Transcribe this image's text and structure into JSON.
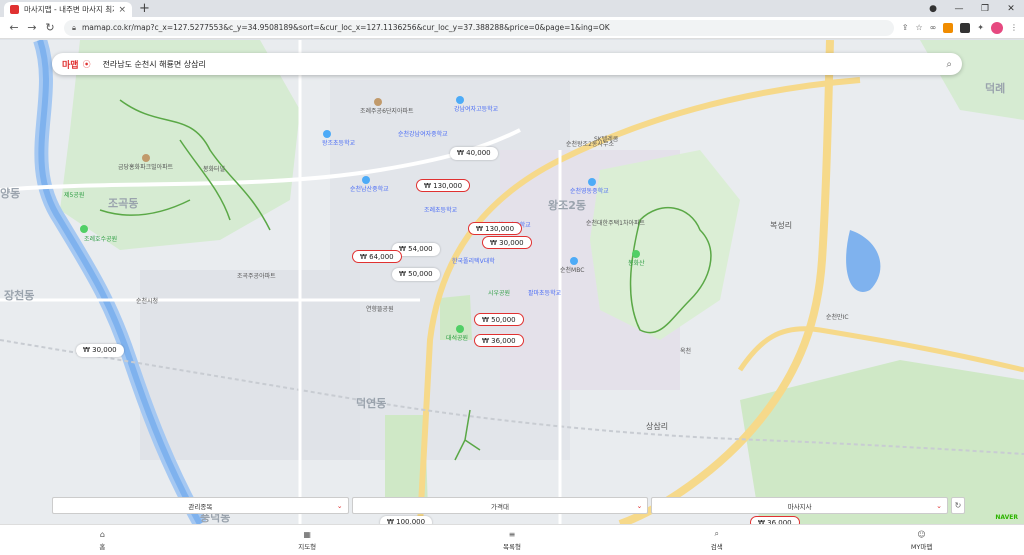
{
  "browser": {
    "tab_title": "마사지맵 - 내주변 마사지 최저가",
    "tab_close": "×",
    "new_tab": "+",
    "url": "mamap.co.kr/map?c_x=127.5277553&c_y=34.9508189&sort=&cur_loc_x=127.1136256&cur_loc_y=37.388288&price=0&page=1&ing=OK"
  },
  "search": {
    "brand": "마맵",
    "value": "전라남도 순천시 해룡면 상삼리"
  },
  "map": {
    "districts": [
      "조곡동",
      "왕조2동",
      "장천동",
      "덕연동",
      "상삼리",
      "복성리",
      "덕례",
      "양동",
      "풍덕동"
    ],
    "roads": [
      "봉화터널",
      "순천만IC"
    ],
    "places": [
      "조례주공6단지아파트",
      "강남여자고등학교",
      "왕조초등학교",
      "순천강남여자중학교",
      "금당홍화파크빌아파트",
      "조곡주공아파트",
      "제5공원",
      "순천시청",
      "조례호수공원",
      "순천남산중학교",
      "조례초등학교",
      "순천왕조2동사무소",
      "SK텔레콤",
      "순천대한주택1차아파트",
      "순천영동중학교",
      "순천금당중학교",
      "한국폴리텍V대학",
      "순천MBC",
      "시우공원",
      "팔마초등학교",
      "연향뜰공원",
      "대석공원",
      "봉화산",
      "옥천"
    ],
    "prices": [
      "₩ 40,000",
      "₩ 130,000",
      "₩ 130,000",
      "₩ 30,000",
      "₩ 54,000",
      "₩ 64,000",
      "₩ 50,000",
      "₩ 50,000",
      "₩ 36,000",
      "₩ 30,000",
      "₩ 100,000",
      "₩ 36,000"
    ]
  },
  "filters": {
    "f1": "관리종목",
    "f2": "가격대",
    "f3": "마사지사",
    "chev": "⌄"
  },
  "attribution": "NAVER",
  "bottom_nav": {
    "items": [
      {
        "label": "홈"
      },
      {
        "label": "지도형"
      },
      {
        "label": "목록형"
      },
      {
        "label": "검색"
      },
      {
        "label": "MY마맵"
      }
    ]
  },
  "colors": {
    "brand": "#e03131",
    "park": "#c9e7c4",
    "river": "#7fb2ee",
    "road": "#f6d98a"
  }
}
